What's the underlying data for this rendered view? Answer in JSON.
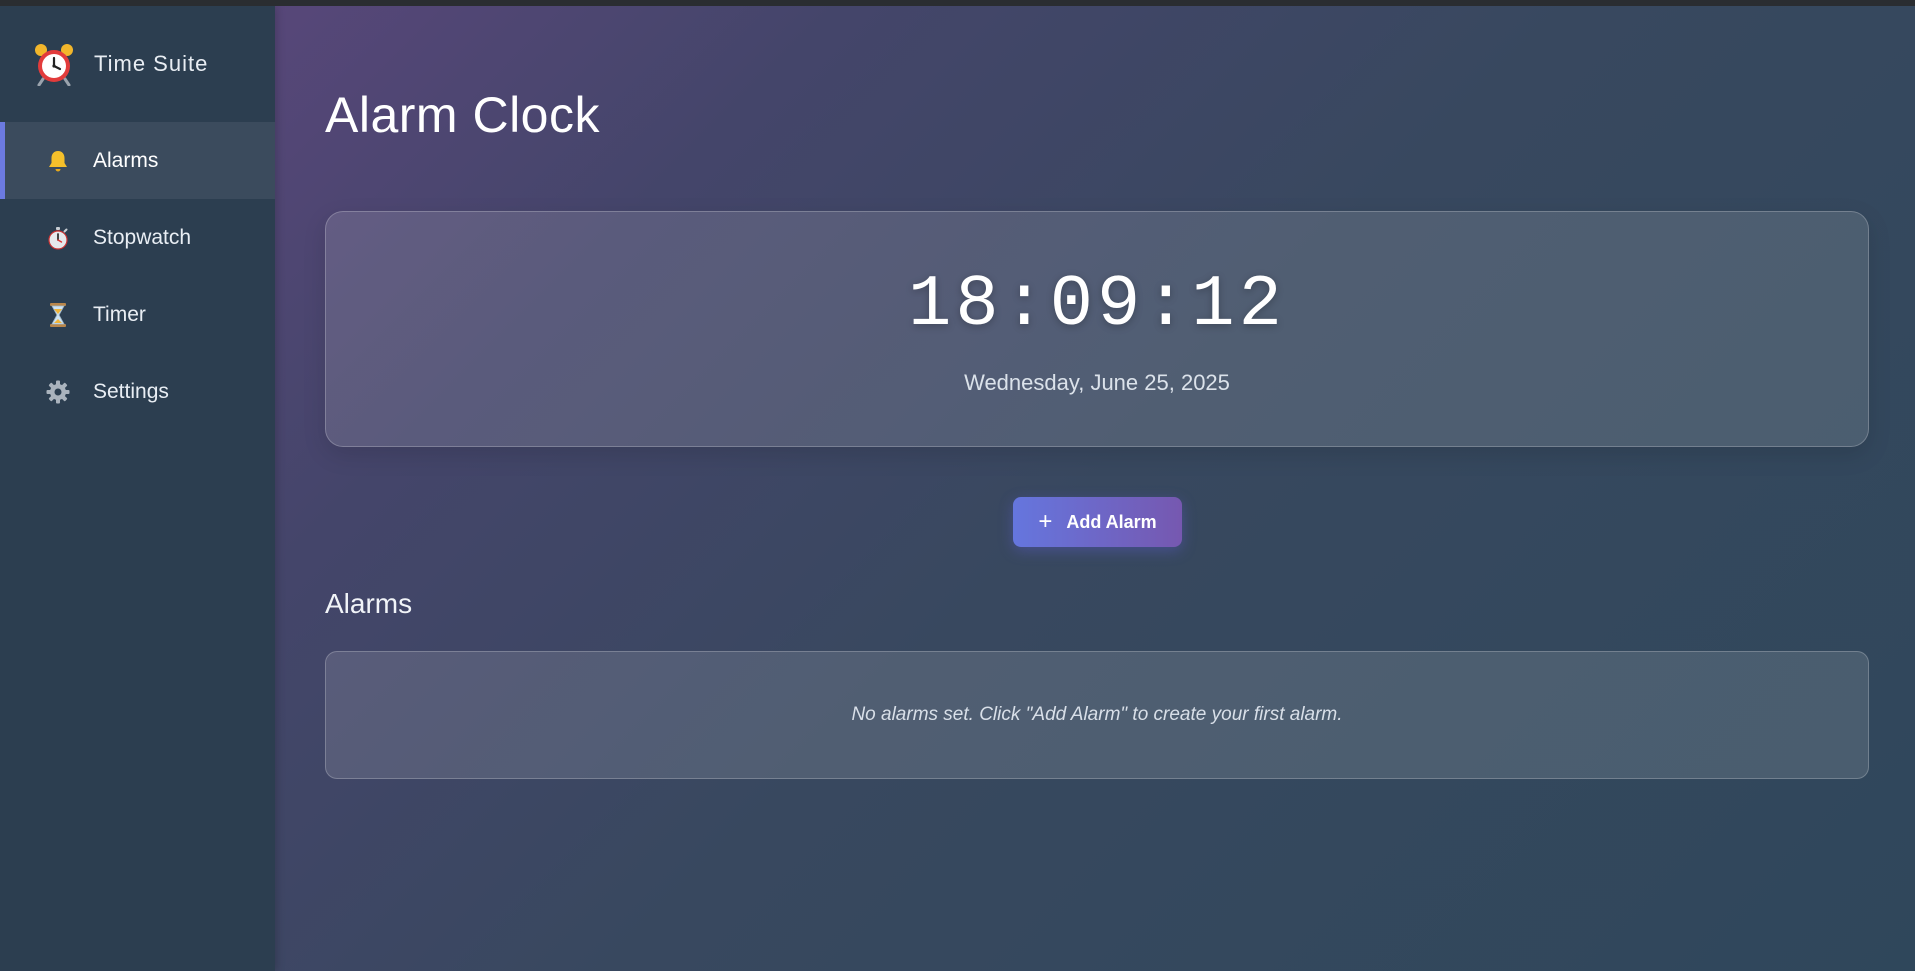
{
  "app": {
    "name": "Time Suite",
    "logo_icon": "alarm-clock-icon"
  },
  "sidebar": {
    "items": [
      {
        "label": "Alarms",
        "icon": "bell-icon",
        "active": true
      },
      {
        "label": "Stopwatch",
        "icon": "stopwatch-icon",
        "active": false
      },
      {
        "label": "Timer",
        "icon": "hourglass-icon",
        "active": false
      },
      {
        "label": "Settings",
        "icon": "gear-icon",
        "active": false
      }
    ]
  },
  "main": {
    "title": "Alarm Clock",
    "clock": {
      "time": "18:09:12",
      "date": "Wednesday, June 25, 2025"
    },
    "add_button": {
      "icon": "plus-icon",
      "label": "Add Alarm"
    },
    "alarms_section": {
      "title": "Alarms",
      "empty_message": "No alarms set. Click \"Add Alarm\" to create your first alarm."
    }
  },
  "colors": {
    "accent": "#6c7ae0",
    "sidebar_bg": "#2c3e50",
    "button_gradient_start": "#6576de",
    "button_gradient_end": "#7658b0"
  }
}
